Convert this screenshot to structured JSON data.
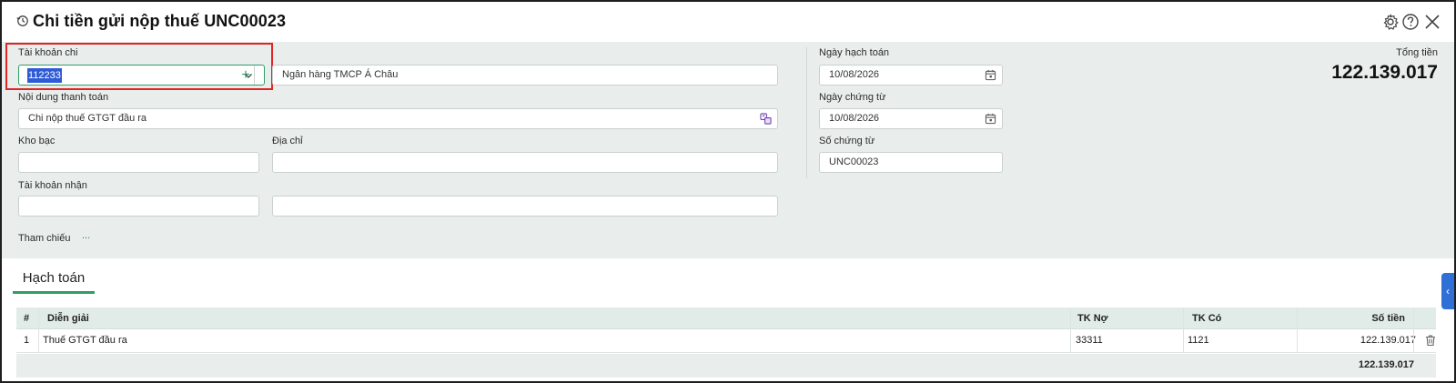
{
  "header": {
    "title": "Chi tiền gửi nộp thuế UNC00023",
    "icons": [
      "history-icon",
      "gear-icon",
      "help-icon",
      "close-icon"
    ]
  },
  "form": {
    "account_label": "Tài khoản chi",
    "account_value": "112233",
    "bank_name": "Ngân hàng TMCP Á Châu",
    "content_label": "Nội dung thanh toán",
    "content_value": "Chi nộp thuế GTGT đầu ra",
    "treasury_label": "Kho bạc",
    "treasury_value": "",
    "address_label": "Địa chỉ",
    "address_value": "",
    "receive_account_label": "Tài khoản nhận",
    "receive_account_value": "",
    "receive_account_name": "",
    "reference_label": "Tham chiếu",
    "reference_more": "...",
    "posting_date_label": "Ngày hạch toán",
    "posting_date": "10/08/2026",
    "voucher_date_label": "Ngày chứng từ",
    "voucher_date": "10/08/2026",
    "voucher_no_label": "Số chứng từ",
    "voucher_no": "UNC00023",
    "total_label": "Tổng tiền",
    "total_value": "122.139.017"
  },
  "tabs": [
    {
      "label": "Hạch toán",
      "active": true
    }
  ],
  "table": {
    "headers": {
      "index": "#",
      "desc": "Diễn giải",
      "debit": "TK Nợ",
      "credit": "TK Có",
      "amount": "Số tiền"
    },
    "rows": [
      {
        "index": "1",
        "desc": "Thuế GTGT đầu ra",
        "debit": "33311",
        "credit": "1121",
        "amount": "122.139.017"
      }
    ],
    "footer_total": "122.139.017"
  },
  "colors": {
    "accent": "#2e9e66",
    "form_bg": "#e9eeed",
    "header_row_bg": "#e1ebe7",
    "highlight": "#e02424",
    "selection": "#2f5bd8"
  }
}
